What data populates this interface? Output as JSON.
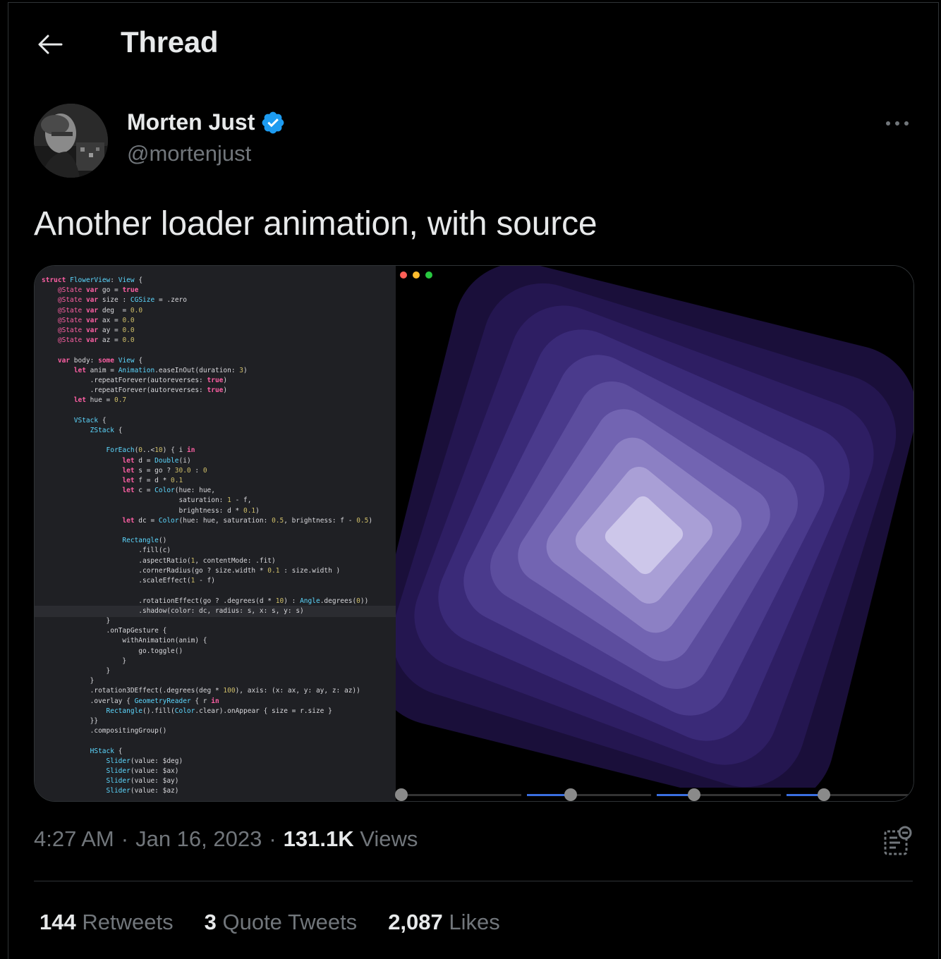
{
  "header": {
    "title": "Thread"
  },
  "author": {
    "display_name": "Morten Just",
    "handle": "@mortenjust",
    "verified": true
  },
  "tweet": {
    "text": "Another loader animation, with source"
  },
  "media": {
    "code": [
      "struct FlowerView: View {",
      "    @State var go = true",
      "    @State var size : CGSize = .zero",
      "    @State var deg  = 0.0",
      "    @State var ax = 0.0",
      "    @State var ay = 0.0",
      "    @State var az = 0.0",
      "",
      "    var body: some View {",
      "        let anim = Animation.easeInOut(duration: 3)",
      "            .repeatForever(autoreverses: true)",
      "            .repeatForever(autoreverses: true)",
      "        let hue = 0.7",
      "",
      "        VStack {",
      "            ZStack {",
      "",
      "                ForEach(0..<10) { i in",
      "                    let d = Double(i)",
      "                    let s = go ? 30.0 : 0",
      "                    let f = d * 0.1",
      "                    let c = Color(hue: hue,",
      "                                  saturation: 1 - f,",
      "                                  brightness: d * 0.1)",
      "                    let dc = Color(hue: hue, saturation: 0.5, brightness: f - 0.5)",
      "",
      "                    Rectangle()",
      "                        .fill(c)",
      "                        .aspectRatio(1, contentMode: .fit)",
      "                        .cornerRadius(go ? size.width * 0.1 : size.width )",
      "                        .scaleEffect(1 - f)",
      "",
      "                        .rotationEffect(go ? .degrees(d * 10) : Angle.degrees(0))",
      "                        .shadow(color: dc, radius: s, x: s, y: s)",
      "                }",
      "                .onTapGesture {",
      "                    withAnimation(anim) {",
      "                        go.toggle()",
      "                    }",
      "                }",
      "            }",
      "            .rotation3DEffect(.degrees(deg * 100), axis: (x: ax, y: ay, z: az))",
      "            .overlay { GeometryReader { r in",
      "                Rectangle().fill(Color.clear).onAppear { size = r.size }",
      "            }}",
      "            .compositingGroup()",
      "",
      "            HStack {",
      "                Slider(value: $deg)",
      "                Slider(value: $ax)",
      "                Slider(value: $ay)",
      "                Slider(value: $az)"
    ],
    "square_colors": [
      "#1a0f3a",
      "#241650",
      "#2e1e63",
      "#3a2a78",
      "#4a3a8c",
      "#5c4d9e",
      "#7264b2",
      "#8c80c4",
      "#a99fd6",
      "#cdc7ea"
    ],
    "window_dots": [
      "#ff5f57",
      "#febc2e",
      "#28c840"
    ],
    "sliders": [
      0.0,
      0.35,
      0.3,
      0.3
    ]
  },
  "meta": {
    "time": "4:27 AM",
    "sep1": "·",
    "date": "Jan 16, 2023",
    "sep2": "·",
    "views_count": "131.1K",
    "views_label": "Views"
  },
  "stats": {
    "retweets_count": "144",
    "retweets_label": "Retweets",
    "quotes_count": "3",
    "quotes_label": "Quote Tweets",
    "likes_count": "2,087",
    "likes_label": "Likes"
  },
  "colors": {
    "background": "#000000",
    "text": "#e7e9ea",
    "muted": "#71767b",
    "border": "#2f3336",
    "verified_blue": "#1d9bf0"
  }
}
